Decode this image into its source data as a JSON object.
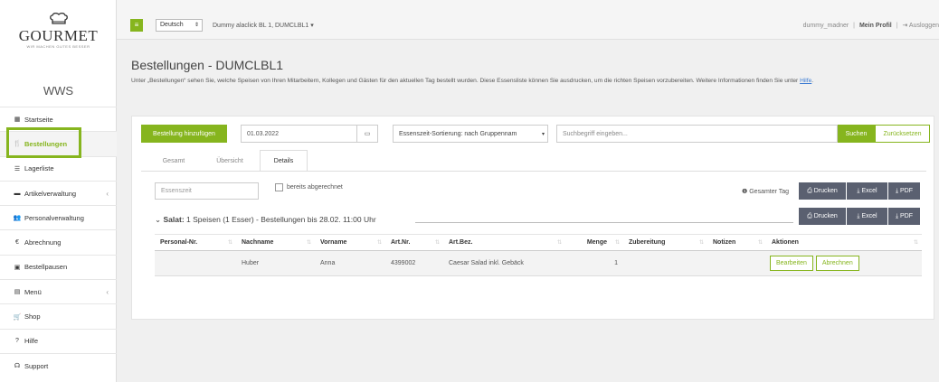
{
  "sidebar": {
    "logo_name": "GOURMET",
    "logo_tagline": "WIR MACHEN GUTES BESSER",
    "app_name": "WWS",
    "items": [
      {
        "label": "Startseite"
      },
      {
        "label": "Bestellungen"
      },
      {
        "label": "Lagerliste"
      },
      {
        "label": "Artikelverwaltung"
      },
      {
        "label": "Personalverwaltung"
      },
      {
        "label": "Abrechnung"
      },
      {
        "label": "Bestellpausen"
      },
      {
        "label": "Menü"
      },
      {
        "label": "Shop"
      },
      {
        "label": "Hilfe"
      },
      {
        "label": "Support"
      }
    ]
  },
  "topbar": {
    "language": "Deutsch",
    "customer": "Dummy alaclick BL 1, DUMCLBL1",
    "username": "dummy_madner",
    "profile_label": "Mein Profil",
    "logout_label": "Ausloggen"
  },
  "page": {
    "title": "Bestellungen - DUMCLBL1",
    "description": "Unter „Bestellungen“ sehen Sie, welche Speisen von Ihren Mitarbeitern, Kollegen und Gästen für den aktuellen Tag bestellt wurden. Diese Essensliste können Sie ausdrucken, um die richten Speisen vorzubereiten. Weitere Informationen finden Sie unter",
    "help_link": "Hilfe",
    "help_suffix": "."
  },
  "toolbar": {
    "add_order_label": "Bestellung hinzufügen",
    "date_value": "01.03.2022",
    "sort_value": "Essenszeit-Sortierung: nach Gruppennam",
    "search_placeholder": "Suchbegriff eingeben...",
    "search_label": "Suchen",
    "reset_label": "Zurücksetzen"
  },
  "tabs": [
    {
      "label": "Gesamt"
    },
    {
      "label": "Übersicht"
    },
    {
      "label": "Details"
    }
  ],
  "filters": {
    "mealtime_placeholder": "Essenszeit",
    "settled_label": "bereits abgerechnet",
    "whole_day_label": "Gesamter Tag"
  },
  "export": {
    "print_label": "Drucken",
    "excel_label": "Excel",
    "pdf_label": "PDF"
  },
  "section": {
    "category": "Salat:",
    "summary": "1 Speisen (1 Esser) - Bestellungen bis 28.02. 11:00 Uhr"
  },
  "table": {
    "headers": [
      "Personal-Nr.",
      "Nachname",
      "Vorname",
      "Art.Nr.",
      "Art.Bez.",
      "Menge",
      "Zubereitung",
      "Notizen",
      "Aktionen"
    ],
    "rows": [
      {
        "personal_nr": "",
        "nachname": "Huber",
        "vorname": "Anna",
        "art_nr": "4399002",
        "art_bez": "Caesar Salad inkl. Gebäck",
        "menge": "1",
        "zubereitung": "",
        "notizen": "",
        "edit_label": "Bearbeiten",
        "settle_label": "Abrechnen"
      }
    ]
  },
  "colors": {
    "accent": "#86b51e",
    "dark_button": "#5a6070",
    "link": "#3a7ad2"
  }
}
